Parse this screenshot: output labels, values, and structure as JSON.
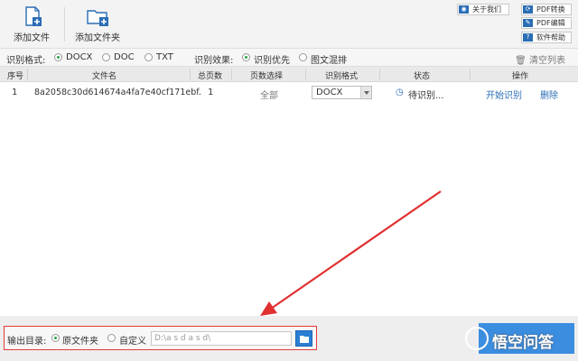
{
  "toolbar": {
    "add_file": "添加文件",
    "add_folder": "添加文件夹",
    "about": "关于我们",
    "pdf_convert": "PDF转换",
    "pdf_edit": "PDF编辑",
    "help": "软件帮助"
  },
  "options": {
    "format_label": "识别格式:",
    "formats": [
      "DOCX",
      "DOC",
      "TXT"
    ],
    "selected_format": "DOCX",
    "effect_label": "识别效果:",
    "effects": [
      "识别优先",
      "图文混排"
    ],
    "selected_effect": "识别优先",
    "clear_list": "清空列表"
  },
  "table": {
    "headers": [
      "序号",
      "文件名",
      "总页数",
      "页数选择",
      "识别格式",
      "状态",
      "操作"
    ],
    "rows": [
      {
        "index": "1",
        "filename": "8a2058c30d614674a4fa7e40cf171ebf.",
        "total_pages": "1",
        "page_select": "全部",
        "format": "DOCX",
        "status": "待识别...",
        "action_start": "开始识别",
        "action_delete": "删除"
      }
    ]
  },
  "output": {
    "label": "输出目录:",
    "option_original": "原文件夹",
    "option_custom": "自定义",
    "path": "D:\\a s d a s d\\"
  },
  "watermark": {
    "text": "悟空问答"
  },
  "colors": {
    "accent": "#2a6db5",
    "radio_on": "#2aa24a",
    "highlight_border": "#e23b3b",
    "arrow": "#e03030"
  }
}
